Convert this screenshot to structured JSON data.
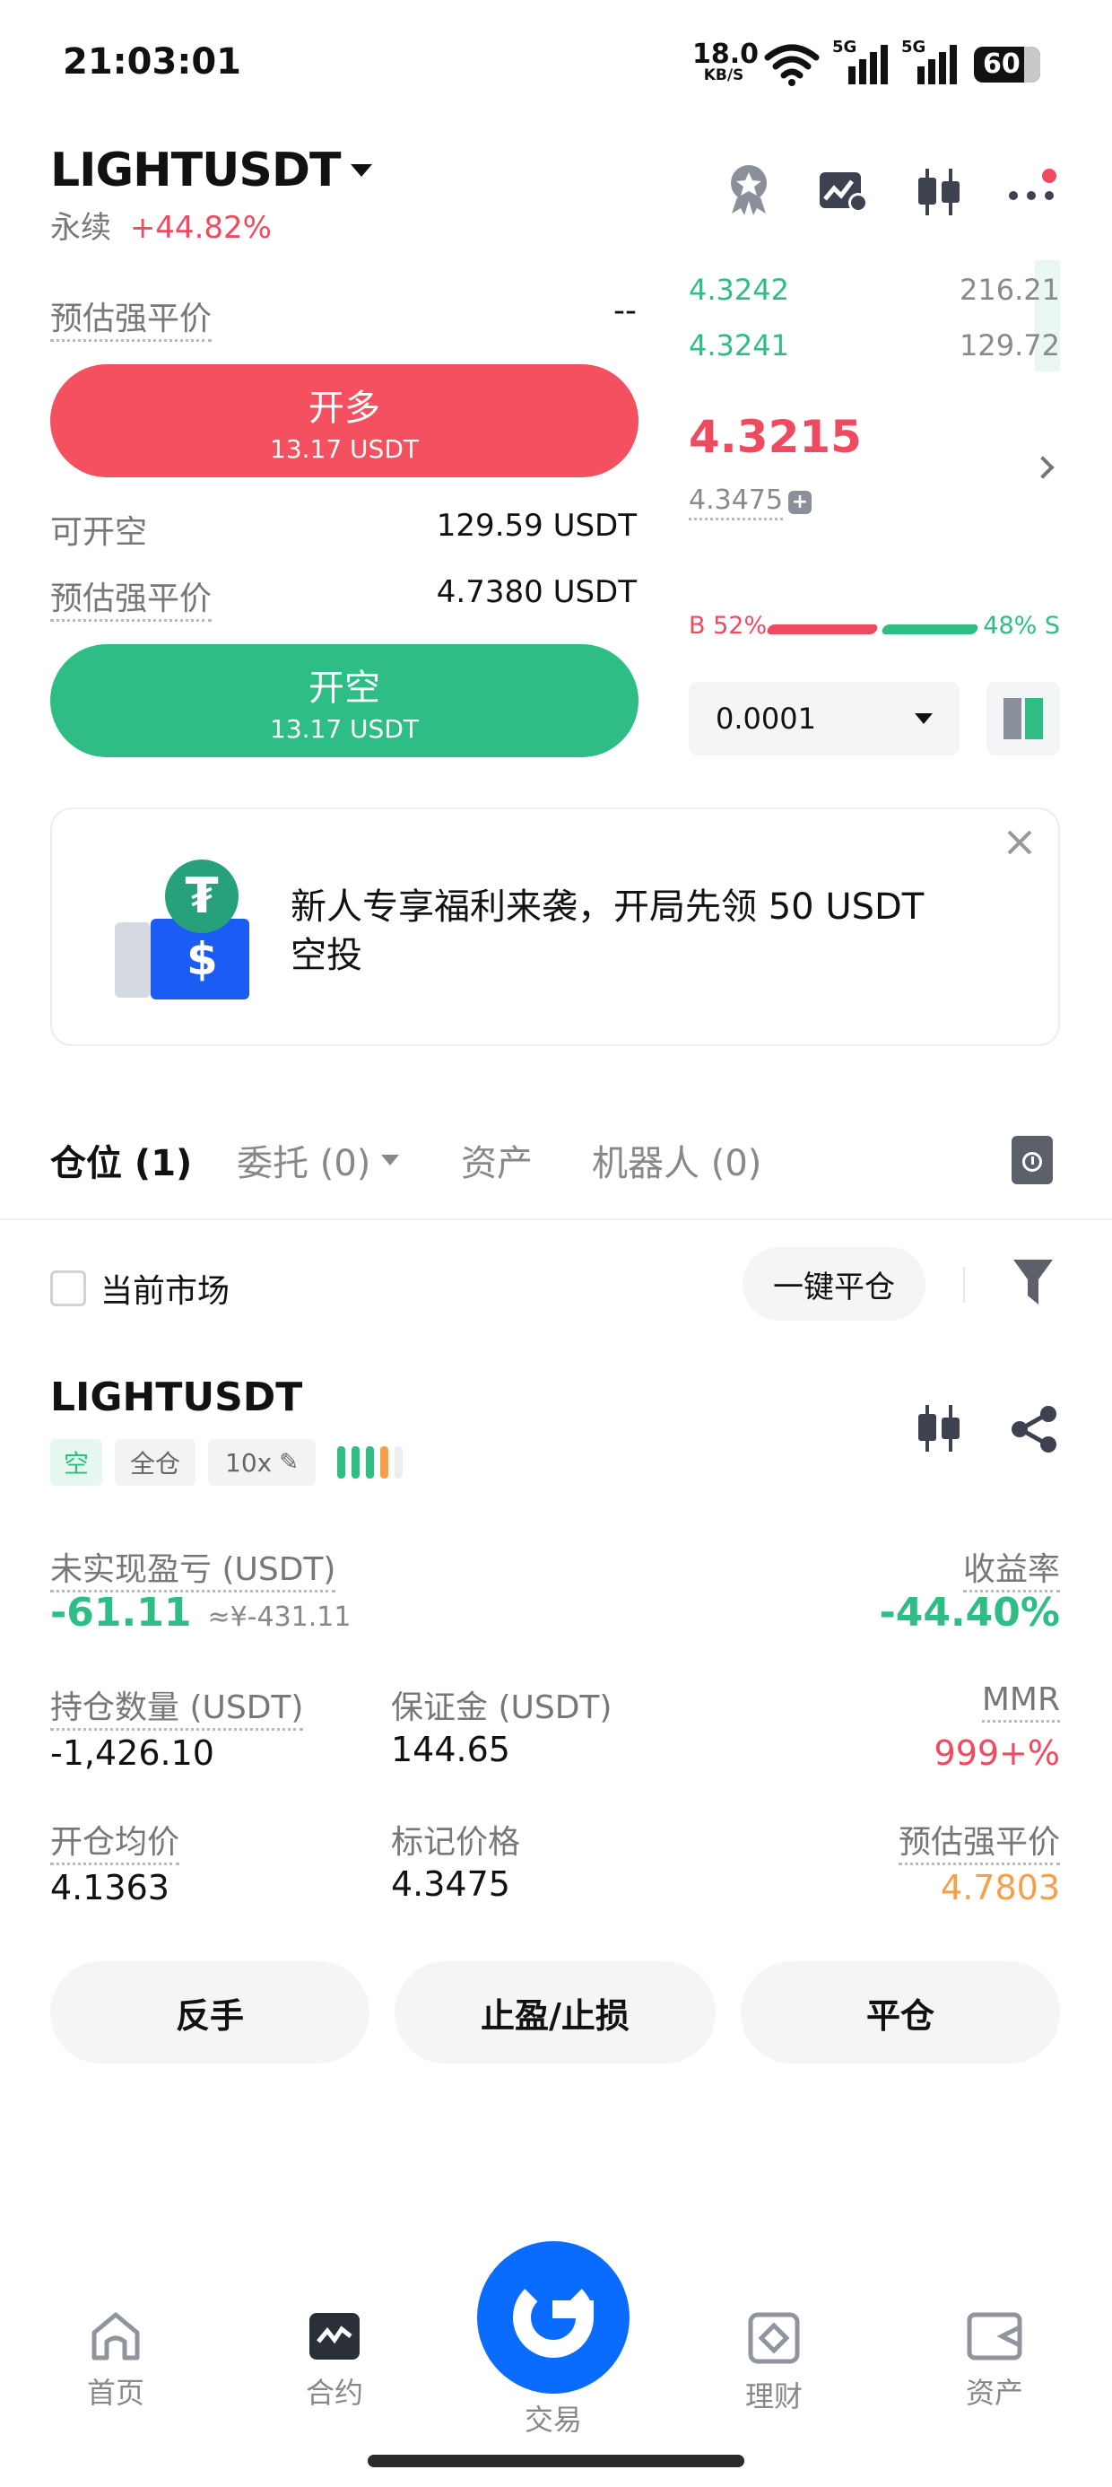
{
  "status_bar": {
    "time": "21:03:01",
    "speed_value": "18.0",
    "speed_unit": "KB/S",
    "sig1": "5G",
    "sig2": "5G",
    "battery": "60"
  },
  "header": {
    "symbol": "LIGHTUSDT",
    "contract_type": "永续",
    "change": "+44.82%"
  },
  "order_panel": {
    "liq_label_1": "预估强平价",
    "liq_value_1": "--",
    "long_button": {
      "label": "开多",
      "sub": "13.17 USDT"
    },
    "short_avail_label": "可开空",
    "short_avail_value": "129.59 USDT",
    "liq_label_2": "预估强平价",
    "liq_value_2": "4.7380 USDT",
    "short_button": {
      "label": "开空",
      "sub": "13.17 USDT"
    }
  },
  "orderbook": {
    "bids": [
      {
        "price": "4.3242",
        "qty": "216.21"
      },
      {
        "price": "4.3241",
        "qty": "129.72"
      }
    ],
    "last_price": "4.3215",
    "mark_price": "4.3475",
    "buy_ratio": "B 52%",
    "sell_ratio": "48% S",
    "buy_pct": 52,
    "precision": "0.0001"
  },
  "promo": {
    "text_line1": "新人专享福利来袭，开局先领 50 USDT",
    "text_line2": "空投",
    "tether_symbol": "₮",
    "dollar_symbol": "$"
  },
  "tabs": [
    {
      "label": "仓位 (1)"
    },
    {
      "label": "委托 (0)"
    },
    {
      "label": "资产"
    },
    {
      "label": "机器人 (0)"
    }
  ],
  "filter_bar": {
    "checkbox_label": "当前市场",
    "close_all_label": "一键平仓"
  },
  "position": {
    "symbol": "LIGHTUSDT",
    "side_tag": "空",
    "margin_tag": "全仓",
    "leverage_tag": "10x",
    "pnl_label": "未实现盈亏 (USDT)",
    "pnl_value": "-61.11",
    "pnl_cny": "≈¥-431.11",
    "roe_label": "收益率",
    "roe_value": "-44.40%",
    "size_label": "持仓数量 (USDT)",
    "size_value": "-1,426.10",
    "margin_label": "保证金 (USDT)",
    "margin_value": "144.65",
    "mmr_label": "MMR",
    "mmr_value": "999+%",
    "entry_label": "开仓均价",
    "entry_value": "4.1363",
    "mark_label": "标记价格",
    "mark_value": "4.3475",
    "liq_label": "预估强平价",
    "liq_value": "4.7803",
    "reverse_label": "反手",
    "tpsl_label": "止盈/止损",
    "close_label": "平仓"
  },
  "bottom_nav": [
    {
      "label": "首页",
      "icon": "home-icon"
    },
    {
      "label": "合约",
      "icon": "futures-icon"
    },
    {
      "label": "交易",
      "icon": "trade-icon"
    },
    {
      "label": "理财",
      "icon": "earn-icon"
    },
    {
      "label": "资产",
      "icon": "wallet-icon"
    }
  ],
  "colors": {
    "green": "#2ebd85",
    "red": "#ef4a5f",
    "orange": "#f5a048",
    "blue": "#0a6cff"
  }
}
